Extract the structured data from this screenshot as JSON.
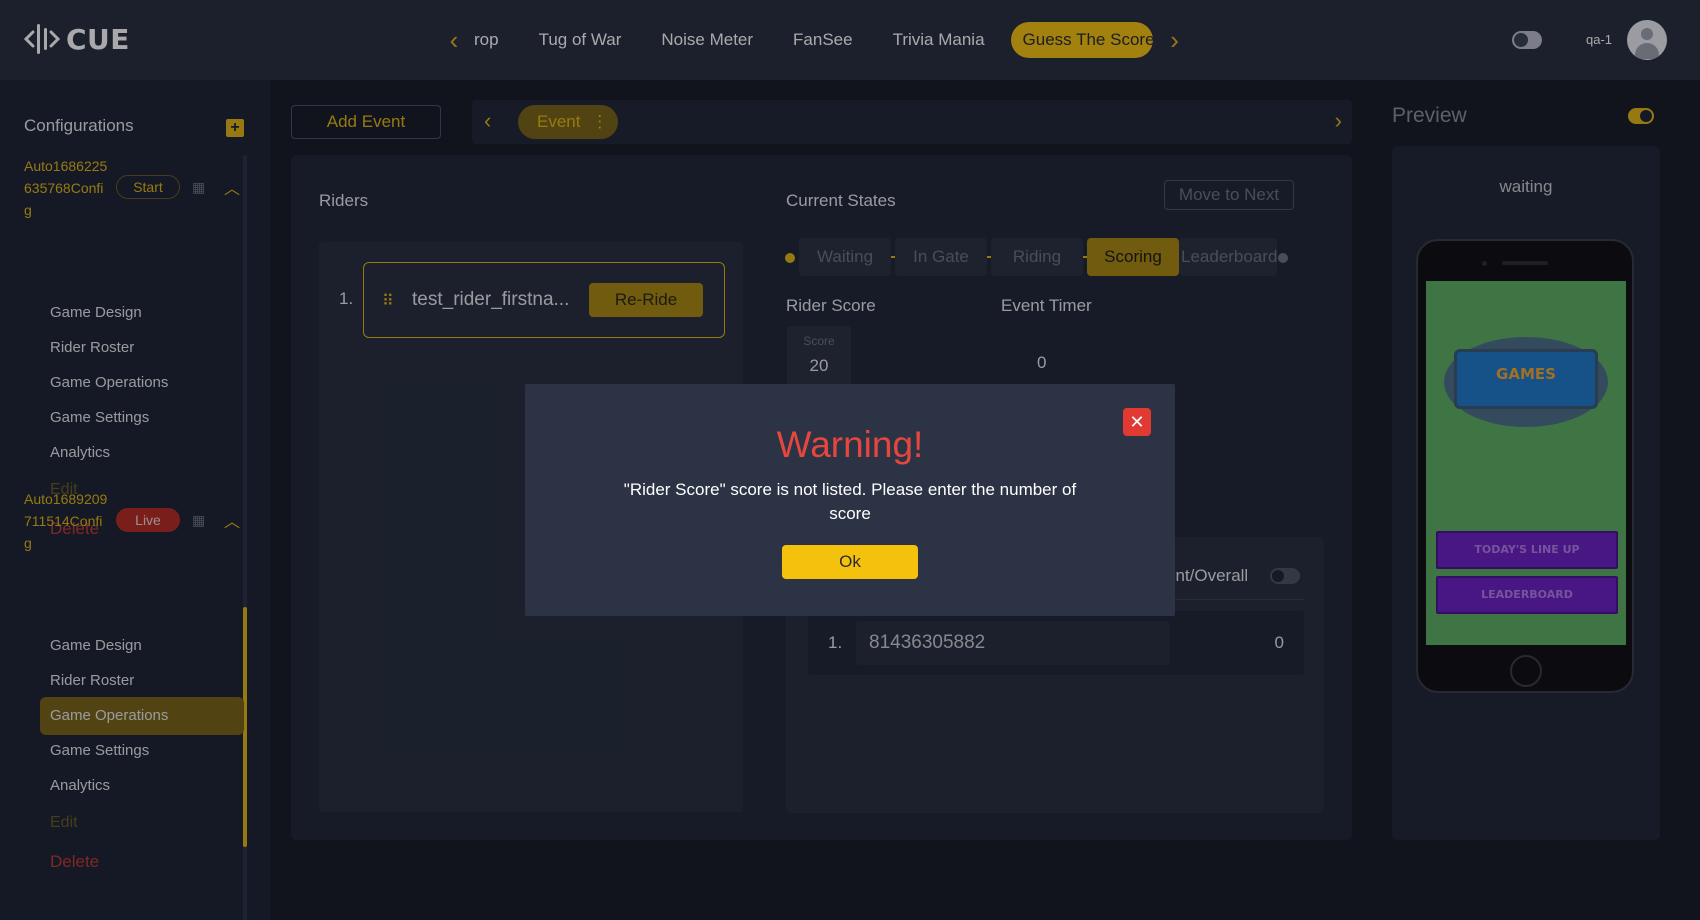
{
  "app": {
    "logo_text": "CUE"
  },
  "topnav": {
    "tabs": [
      "rop",
      "Tug of War",
      "Noise Meter",
      "FanSee",
      "Trivia Mania"
    ],
    "active_tab": "Guess The Score",
    "user": "qa-1"
  },
  "sidebar": {
    "title": "Configurations",
    "configs": [
      {
        "name": "Auto1686225635768Config",
        "badge": "Start",
        "items": [
          "Game Design",
          "Rider Roster",
          "Game Operations",
          "Game Settings",
          "Analytics"
        ],
        "edit": "Edit",
        "delete": "Delete"
      },
      {
        "name": "Auto1689209711514Config",
        "badge": "Live",
        "items": [
          "Game Design",
          "Rider Roster",
          "Game Operations",
          "Game Settings",
          "Analytics"
        ],
        "edit": "Edit",
        "delete": "Delete"
      }
    ],
    "active_item": "Game Operations"
  },
  "main": {
    "add_event": "Add Event",
    "event_pill": "Event",
    "riders_title": "Riders",
    "riders": [
      {
        "rank": "1.",
        "name": "test_rider_firstna...",
        "action": "Re-Ride"
      }
    ],
    "current_states_title": "Current States",
    "move_next": "Move to Next",
    "states": [
      "Waiting",
      "In Gate",
      "Riding",
      "Scoring",
      "Leaderboard"
    ],
    "active_state": "Scoring",
    "rider_score_title": "Rider Score",
    "event_timer_title": "Event Timer",
    "score_label": "Score",
    "score_value": "20",
    "timer_value": "0",
    "leaderboard_toggle_label": "ent/Overall",
    "leaderboard": [
      {
        "rank": "1.",
        "name": "81436305882",
        "score": "0"
      }
    ]
  },
  "preview": {
    "title": "Preview",
    "status": "waiting",
    "game_logo": "GAMES",
    "buttons": [
      "TODAY'S LINE UP",
      "LEADERBOARD"
    ]
  },
  "modal": {
    "title": "Warning!",
    "message": "\"Rider Score\" score is not listed. Please enter the number of score",
    "ok": "Ok"
  },
  "colors": {
    "accent": "#f4c20d",
    "warning": "#e5473e",
    "live": "#b52a1f",
    "background": "#161b24"
  }
}
